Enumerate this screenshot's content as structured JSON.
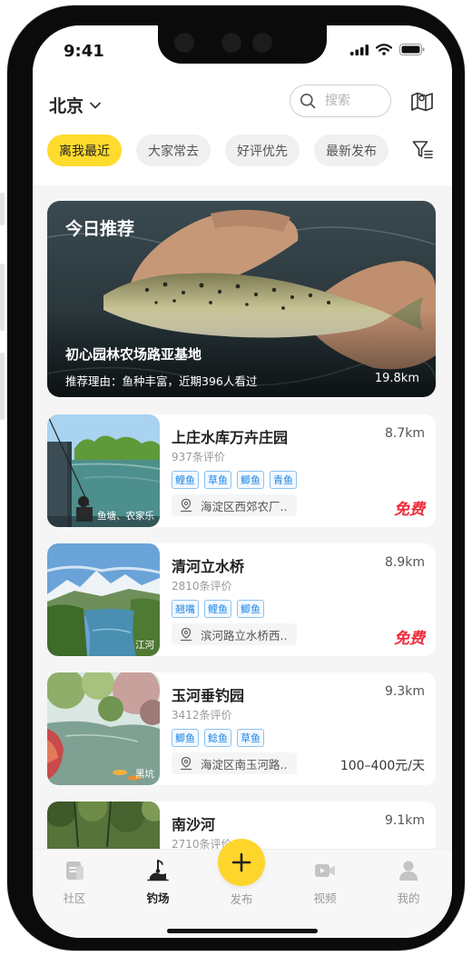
{
  "status": {
    "time": "9:41"
  },
  "header": {
    "city": "北京",
    "search_placeholder": "搜索",
    "chips": [
      "离我最近",
      "大家常去",
      "好评优先",
      "最新发布"
    ]
  },
  "featured": {
    "title": "今日推荐",
    "name": "初心园林农场路亚基地",
    "reason": "推荐理由：鱼种丰富，近期396人看过",
    "distance": "19.8km"
  },
  "spots": [
    {
      "name": "上庄水库万卉庄园",
      "distance": "8.7km",
      "reviews": "937条评价",
      "tags": [
        "鲤鱼",
        "草鱼",
        "鲫鱼",
        "青鱼"
      ],
      "address": "海淀区西郊农厂..",
      "price": "免费",
      "photo_tag": "鱼塘、农家乐"
    },
    {
      "name": "清河立水桥",
      "distance": "8.9km",
      "reviews": "2810条评价",
      "tags": [
        "翘嘴",
        "鲤鱼",
        "鲫鱼"
      ],
      "address": "滨河路立水桥西..",
      "price": "免费",
      "photo_tag": "江河"
    },
    {
      "name": "玉河垂钓园",
      "distance": "9.3km",
      "reviews": "3412条评价",
      "tags": [
        "鲫鱼",
        "鲶鱼",
        "草鱼"
      ],
      "address": "海淀区南玉河路..",
      "price": "100–400元/天",
      "photo_tag": "黑坑"
    },
    {
      "name": "南沙河",
      "distance": "9.1km",
      "reviews": "2710条评价"
    }
  ],
  "tabbar": {
    "items": [
      "社区",
      "钓场",
      "发布",
      "视频",
      "我的"
    ],
    "active": "钓场"
  },
  "colors": {
    "accent": "#fedb2c",
    "tag_blue": "#1f86e6",
    "free_red": "#ee2d3c"
  }
}
